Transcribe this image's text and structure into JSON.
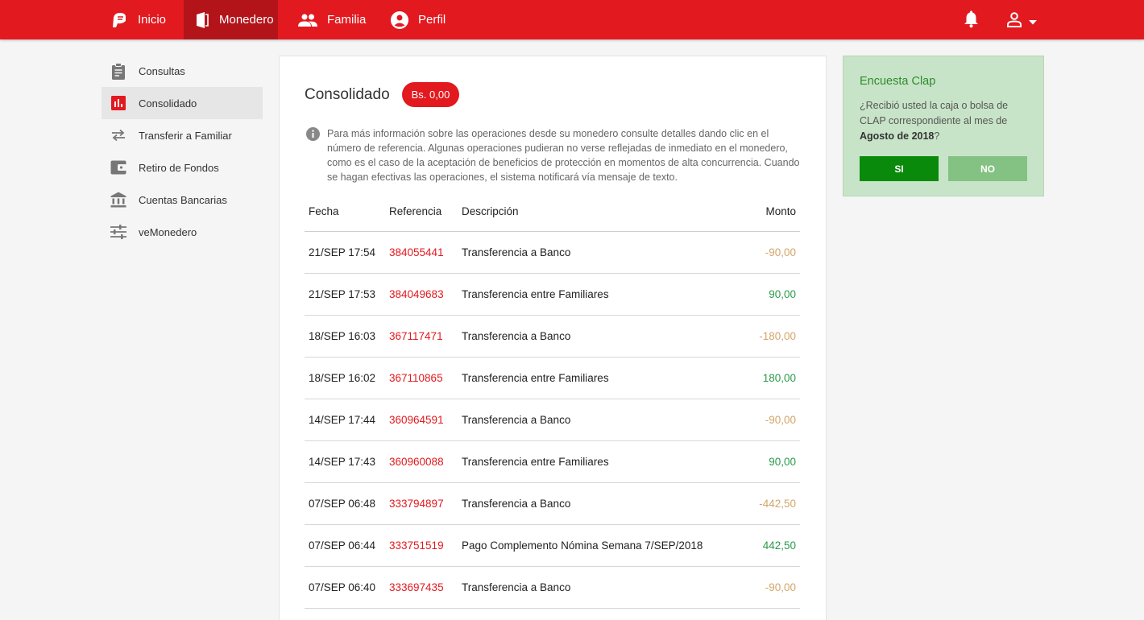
{
  "nav": {
    "items": [
      {
        "label": "Inicio",
        "icon": "logo-icon"
      },
      {
        "label": "Monedero",
        "icon": "wallet-icon",
        "active": true
      },
      {
        "label": "Familia",
        "icon": "people-icon"
      },
      {
        "label": "Perfil",
        "icon": "account-circle-icon"
      }
    ],
    "notification_icon": "bell-icon",
    "user_icon": "user-icon"
  },
  "sidebar": {
    "items": [
      {
        "label": "Consultas",
        "icon": "clipboard-icon"
      },
      {
        "label": "Consolidado",
        "icon": "bar-chart-icon",
        "active": true
      },
      {
        "label": "Transferir a Familiar",
        "icon": "swap-arrows-icon"
      },
      {
        "label": "Retiro de Fondos",
        "icon": "wallet-withdraw-icon"
      },
      {
        "label": "Cuentas Bancarias",
        "icon": "bank-icon"
      },
      {
        "label": "veMonedero",
        "icon": "sliders-icon"
      }
    ]
  },
  "main": {
    "title": "Consolidado",
    "balance": "Bs. 0,00",
    "info": "Para más información sobre las operaciones desde su monedero consulte detalles dando clic en el número de referencia. Algunas operaciones pudieran no verse reflejadas de inmediato en el monedero, como es el caso de la aceptación de beneficios de protección en momentos de alta concurrencia. Cuando se hagan efectivas las operaciones, el sistema notificará vía mensaje de texto.",
    "table": {
      "headers": {
        "fecha": "Fecha",
        "referencia": "Referencia",
        "descripcion": "Descripción",
        "monto": "Monto"
      },
      "rows": [
        {
          "fecha": "21/SEP 17:54",
          "ref": "384055441",
          "desc": "Transferencia a Banco",
          "monto": "-90,00"
        },
        {
          "fecha": "21/SEP 17:53",
          "ref": "384049683",
          "desc": "Transferencia entre Familiares",
          "monto": "90,00"
        },
        {
          "fecha": "18/SEP 16:03",
          "ref": "367117471",
          "desc": "Transferencia a Banco",
          "monto": "-180,00"
        },
        {
          "fecha": "18/SEP 16:02",
          "ref": "367110865",
          "desc": "Transferencia entre Familiares",
          "monto": "180,00"
        },
        {
          "fecha": "14/SEP 17:44",
          "ref": "360964591",
          "desc": "Transferencia a Banco",
          "monto": "-90,00"
        },
        {
          "fecha": "14/SEP 17:43",
          "ref": "360960088",
          "desc": "Transferencia entre Familiares",
          "monto": "90,00"
        },
        {
          "fecha": "07/SEP 06:48",
          "ref": "333794897",
          "desc": "Transferencia a Banco",
          "monto": "-442,50"
        },
        {
          "fecha": "07/SEP 06:44",
          "ref": "333751519",
          "desc": "Pago Complemento Nómina Semana 7/SEP/2018",
          "monto": "442,50"
        },
        {
          "fecha": "07/SEP 06:40",
          "ref": "333697435",
          "desc": "Transferencia a Banco",
          "monto": "-90,00"
        }
      ]
    }
  },
  "survey": {
    "title": "Encuesta Clap",
    "question_pre": "¿Recibió usted la caja o bolsa de CLAP correspondiente al mes de ",
    "question_bold": "Agosto de 2018",
    "question_post": "?",
    "yes_label": "SI",
    "no_label": "NO"
  },
  "colors": {
    "brand_red": "#e2191f",
    "negative_amount": "#d3a56a",
    "positive_amount": "#2a9a4a",
    "survey_yes": "#0a8a0a",
    "survey_no": "#83c283"
  }
}
